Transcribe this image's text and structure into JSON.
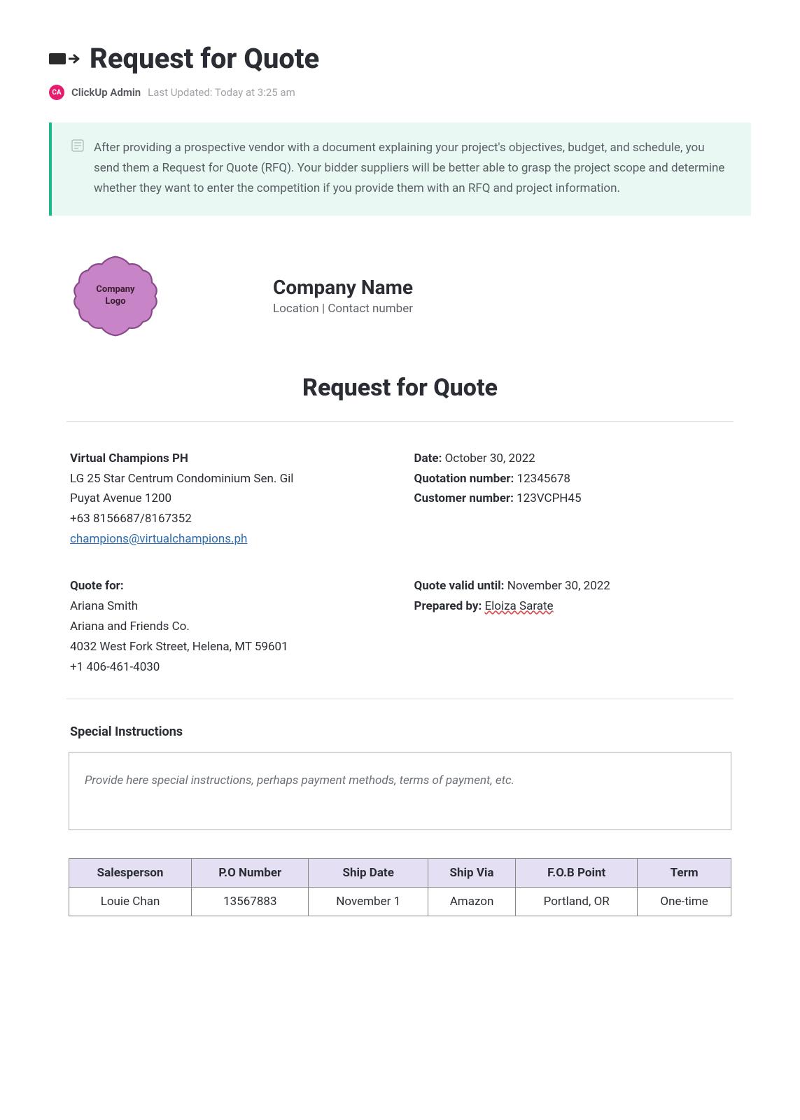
{
  "header": {
    "title": "Request for Quote",
    "author": "ClickUp Admin",
    "avatar_initials": "CA",
    "last_updated": "Last Updated: Today at 3:25 am"
  },
  "info_box": {
    "text": "After providing a prospective vendor with a document explaining your project's objectives, budget, and schedule, you send them a Request for Quote (RFQ). Your bidder suppliers will be better able to grasp the project scope and determine whether they want to enter the competition if you provide them with an RFQ and project information."
  },
  "company_block": {
    "logo_text_line1": "Company",
    "logo_text_line2": "Logo",
    "company_name": "Company Name",
    "company_sub": "Location | Contact number"
  },
  "doc_section_title": "Request for Quote",
  "vendor": {
    "name": "Virtual Champions PH",
    "address_line1": "LG 25 Star Centrum Condominium Sen. Gil",
    "address_line2": "Puyat Avenue 1200",
    "phone": "+63 8156687/8167352",
    "email": "champions@virtualchampions.ph"
  },
  "quote_meta": {
    "date_label": "Date:",
    "date_value": "October 30, 2022",
    "quotation_label": "Quotation number:",
    "quotation_value": "12345678",
    "customer_label": "Customer number:",
    "customer_value": "123VCPH45"
  },
  "quote_for": {
    "heading": "Quote for:",
    "name": "Ariana Smith",
    "company": "Ariana and Friends Co.",
    "address": "4032 West Fork Street, Helena, MT 59601",
    "phone": "+1 406-461-4030"
  },
  "validity": {
    "valid_label": "Quote valid until:",
    "valid_value": "November 30, 2022",
    "prepared_label": "Prepared by:",
    "prepared_value": "Eloiza Sarate"
  },
  "special": {
    "heading": "Special Instructions",
    "placeholder": "Provide here special instructions, perhaps payment methods, terms of payment, etc."
  },
  "table": {
    "headers": {
      "salesperson": "Salesperson",
      "po_number": "P.O Number",
      "ship_date": "Ship Date",
      "ship_via": "Ship Via",
      "fob_point": "F.O.B Point",
      "term": "Term"
    },
    "row": {
      "salesperson": "Louie Chan",
      "po_number": "13567883",
      "ship_date": "November 1",
      "ship_via": "Amazon",
      "fob_point": "Portland, OR",
      "term": "One-time"
    }
  }
}
